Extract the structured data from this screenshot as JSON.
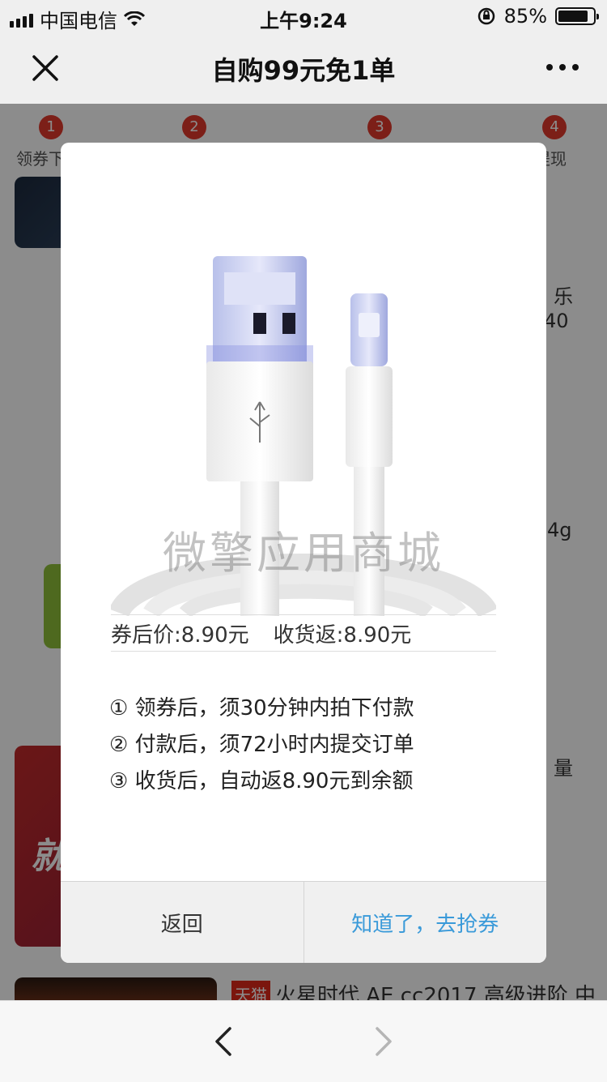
{
  "status_bar": {
    "carrier": "中国电信",
    "time": "上午9:24",
    "battery_percent": "85%",
    "battery_level": 0.85
  },
  "navbar": {
    "title": "自购99元免1单"
  },
  "background": {
    "steps": [
      {
        "num": "1",
        "label": "领券下"
      },
      {
        "num": "2",
        "label": ""
      },
      {
        "num": "3",
        "label": ""
      },
      {
        "num": "4",
        "label": "提现"
      }
    ],
    "fragments": [
      "乐",
      "40",
      "4g",
      "量",
      "火星时代 AE cc2017 高级进阶 中"
    ],
    "tmall_badge": "天猫",
    "promo_text": "就"
  },
  "dialog": {
    "watermark": "微擎应用商城",
    "price_after_coupon": "券后价:8.90元",
    "cashback": "收货返:8.90元",
    "rules": [
      "① 领券后，须30分钟内拍下付款",
      "② 付款后，须72小时内提交订单",
      "③ 收货后，自动返8.90元到余额"
    ],
    "back_label": "返回",
    "confirm_label": "知道了，去抢券"
  }
}
